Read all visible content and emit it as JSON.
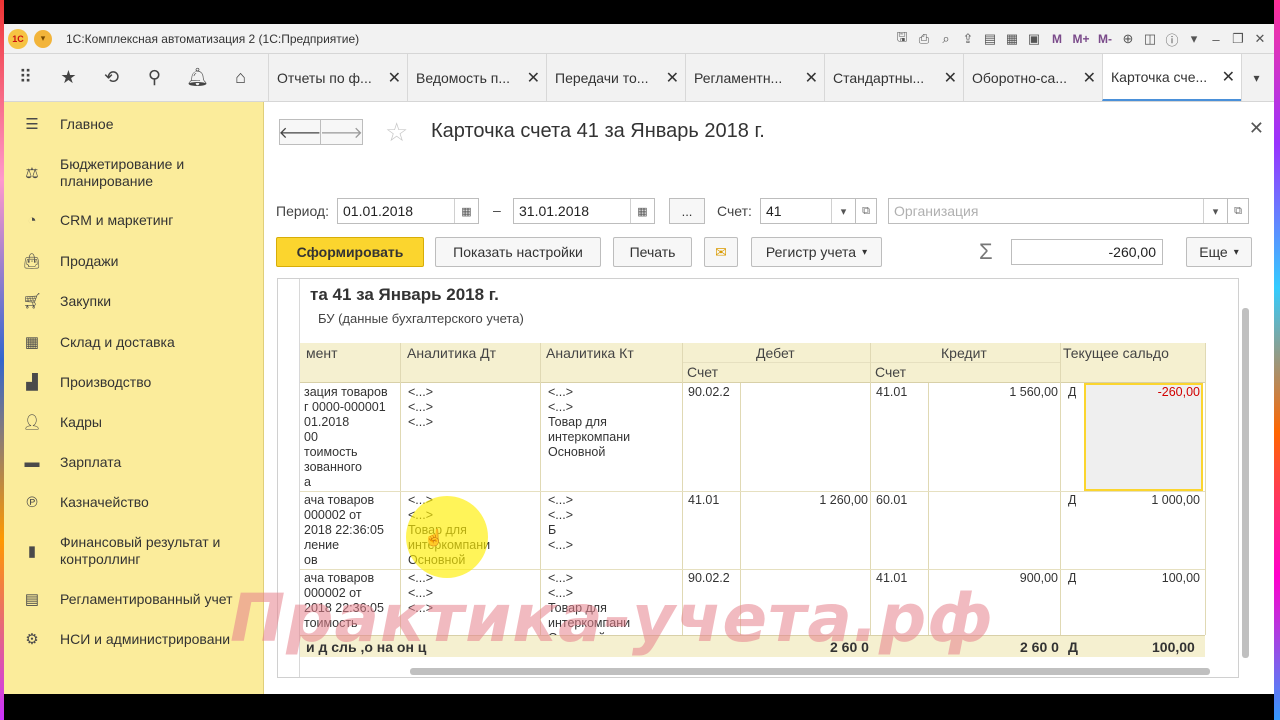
{
  "window": {
    "title": "1С:Комплексная автоматизация 2 (1С:Предприятие)",
    "logo_text": "1С",
    "toolbar_text": [
      "M",
      "M+",
      "M-"
    ]
  },
  "tabs": [
    {
      "label": "Отчеты по ф...",
      "active": false
    },
    {
      "label": "Ведомость п...",
      "active": false
    },
    {
      "label": "Передачи то...",
      "active": false
    },
    {
      "label": "Регламентн...",
      "active": false
    },
    {
      "label": "Стандартны...",
      "active": false
    },
    {
      "label": "Оборотно-са...",
      "active": false
    },
    {
      "label": "Карточка сче...",
      "active": true
    }
  ],
  "sidebar": {
    "items": [
      {
        "label": "Главное",
        "icon": "menu-icon"
      },
      {
        "label": "Бюджетирование и планирование",
        "icon": "budget-icon"
      },
      {
        "label": "CRM и маркетинг",
        "icon": "crm-icon"
      },
      {
        "label": "Продажи",
        "icon": "sales-bag-icon"
      },
      {
        "label": "Закупки",
        "icon": "cart-icon"
      },
      {
        "label": "Склад и доставка",
        "icon": "warehouse-icon"
      },
      {
        "label": "Производство",
        "icon": "factory-icon"
      },
      {
        "label": "Кадры",
        "icon": "person-icon"
      },
      {
        "label": "Зарплата",
        "icon": "wallet-icon"
      },
      {
        "label": "Казначейство",
        "icon": "treasury-icon"
      },
      {
        "label": "Финансовый результат и контроллинг",
        "icon": "bar-chart-icon"
      },
      {
        "label": "Регламентированный учет",
        "icon": "calculator-icon"
      },
      {
        "label": "НСИ и администрировани",
        "icon": "gear-icon"
      }
    ]
  },
  "form": {
    "title": "Карточка счета 41 за Январь 2018 г.",
    "period_label": "Период:",
    "period_from": "01.01.2018",
    "period_separator": "–",
    "period_to": "31.01.2018",
    "dots": "...",
    "account_label": "Счет:",
    "account_value": "41",
    "organization_placeholder": "Организация",
    "buttons": {
      "generate": "Сформировать",
      "show_settings": "Показать настройки",
      "print": "Печать",
      "register": "Регистр учета",
      "more": "Еще"
    },
    "sum_value": "-260,00"
  },
  "report": {
    "title": "та 41 за Январь 2018 г.",
    "subtitle": "БУ (данные бухгалтерского учета)",
    "headers": {
      "document": "мент",
      "analytics_dt": "Аналитика Дт",
      "analytics_kt": "Аналитика Кт",
      "debit": "Дебет",
      "credit": "Кредит",
      "balance": "Текущее сальдо",
      "debit_account": "Счет",
      "credit_account": "Счет"
    },
    "rows": [
      {
        "document": "зация товаров\nг 0000-000001\n01.2018\n00\nтоимость\nзованного\nа",
        "analytics_dt": "<...>\n<...>\n<...>",
        "analytics_kt": "<...>\n<...>\nТовар для\nинтеркомпани\nОсновной",
        "debit_account": "90.02.2",
        "debit_sum": "",
        "credit_account": "41.01",
        "credit_sum": "1 560,00",
        "balance_side": "Д",
        "balance": "-260,00"
      },
      {
        "document": "ача товаров\n000002 от\n2018 22:36:05\nление\nов",
        "analytics_dt": "<...>\n<...>\nТовар для\nинтеркомпани\nОсновной",
        "analytics_kt": "<...>\n<...>\nБ\n<...>",
        "debit_account": "41.01",
        "debit_sum": "1 260,00",
        "credit_account": "60.01",
        "credit_sum": "",
        "balance_side": "Д",
        "balance": "1 000,00"
      },
      {
        "document": "ача товаров\n000002 от\n2018 22:36:05\nтоимость",
        "analytics_dt": "<...>\n<...>\n<...>",
        "analytics_kt": "<...>\n<...>\nТовар для\nинтеркомпани\nОсновной",
        "debit_account": "90.02.2",
        "debit_sum": "",
        "credit_account": "41.01",
        "credit_sum": "900,00",
        "balance_side": "Д",
        "balance": "100,00"
      }
    ],
    "totals": {
      "label": "и д сль ,о на он ц",
      "debit": "2 60 0",
      "credit": "2 60 0",
      "side": "Д",
      "balance": "100,00"
    }
  },
  "watermark": "Практика-учета.рф"
}
